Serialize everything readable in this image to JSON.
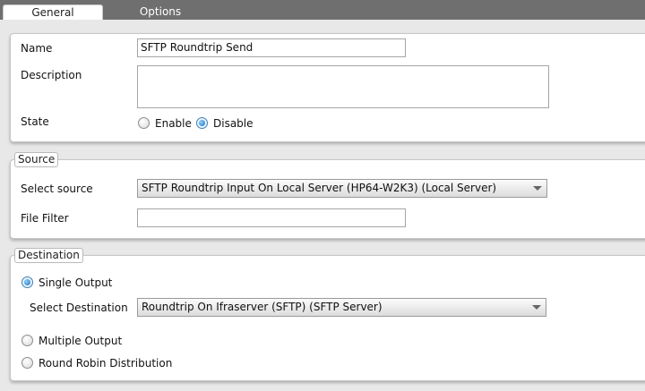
{
  "tabs": {
    "general": "General",
    "options": "Options"
  },
  "general": {
    "name_label": "Name",
    "name_value": "SFTP Roundtrip Send",
    "description_label": "Description",
    "description_value": "",
    "state_label": "State",
    "state_options": {
      "enable": "Enable",
      "disable": "Disable"
    },
    "state_selected": "Disable"
  },
  "source": {
    "legend": "Source",
    "select_label": "Select source",
    "select_value": "SFTP Roundtrip Input On Local Server (HP64-W2K3) (Local Server)",
    "filter_label": "File Filter",
    "filter_value": ""
  },
  "destination": {
    "legend": "Destination",
    "single_output": "Single Output",
    "select_label": "Select Destination",
    "select_value": "Roundtrip On Ifraserver (SFTP) (SFTP Server)",
    "multiple_output": "Multiple Output",
    "round_robin": "Round Robin Distribution",
    "selected_mode": "Single Output"
  }
}
